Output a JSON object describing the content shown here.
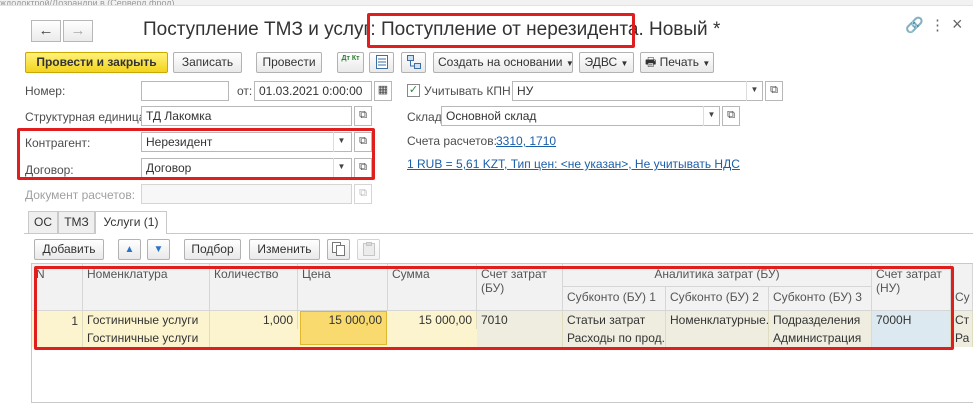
{
  "top_strip_text": "ждодоктрой/Дозрандри в (Серверд фрод)",
  "nav": {
    "back": "←",
    "forward": "→"
  },
  "header": {
    "title_part1": "Поступление ТМЗ и услуг: ",
    "title_part2": "Поступление от нерезидента",
    "title_part3": ". Новый *"
  },
  "window_icons": {
    "link": "🔗",
    "more": "⋮",
    "close": "×"
  },
  "toolbar": {
    "post_close": "Провести и закрыть",
    "save": "Записать",
    "post": "Провести",
    "dt_kt": "Дт Кт",
    "create_based_on": "Создать на основании",
    "edvs": "ЭДВС",
    "print": "Печать"
  },
  "form": {
    "number_label": "Номер:",
    "number_value": "",
    "date_label": "от:",
    "date_value": "01.03.2021  0:00:00",
    "kpn_label": "Учитывать КПН",
    "kpn_checked": "✓",
    "kpn_value": "НУ",
    "unit_label": "Структурная единица:",
    "unit_value": "ТД Лакомка",
    "warehouse_label": "Склад:",
    "warehouse_value": "Основной склад",
    "contractor_label": "Контрагент:",
    "contractor_value": "Нерезидент",
    "accounts_label": "Счета расчетов:",
    "accounts_link": "3310, 1710",
    "contract_label": "Договор:",
    "contract_value": "Договор",
    "rate_link": "1 RUB = 5,61 KZT, Тип цен: <не указан>, Не учитывать НДС",
    "settlement_doc_label": "Документ расчетов:",
    "settlement_doc_value": ""
  },
  "tabs": [
    {
      "label": "ОС"
    },
    {
      "label": "ТМЗ"
    },
    {
      "label": "Услуги (1)"
    }
  ],
  "table_toolbar": {
    "add": "Добавить",
    "up": "▲",
    "down": "▼",
    "select": "Подбор",
    "change": "Изменить"
  },
  "table": {
    "headers": {
      "n": "N",
      "nomenclature": "Номенклатура",
      "quantity": "Количество",
      "price": "Цена",
      "sum": "Сумма",
      "cost_account_bu": "Счет затрат (БУ)",
      "analytics_bu": "Аналитика затрат (БУ)",
      "subconto1": "Субконто (БУ) 1",
      "subconto2": "Субконто (БУ) 2",
      "subconto3": "Субконто (БУ) 3",
      "cost_account_nu": "Счет затрат (НУ)",
      "subconto_cut": "Су"
    },
    "row": {
      "n": "1",
      "nomenclature": "Гостиничные услуги",
      "nomenclature_line2": "Гостиничные услуги",
      "quantity": "1,000",
      "price": "15 000,00",
      "sum": "15 000,00",
      "cost_account_bu": "7010",
      "subconto1": "Статьи затрат",
      "subconto1_line2": "Расходы по прод...",
      "subconto2": "Номенклатурные...",
      "subconto3": "Подразделения",
      "subconto3_line2": "Администрация",
      "cost_account_nu": "7000Н",
      "cut_line1": "Ст",
      "cut_line2": "Ра"
    }
  },
  "colors": {
    "accent_red": "#e01e1e",
    "primary_yellow": "#f3d31e",
    "link_blue": "#1b5ea8"
  }
}
